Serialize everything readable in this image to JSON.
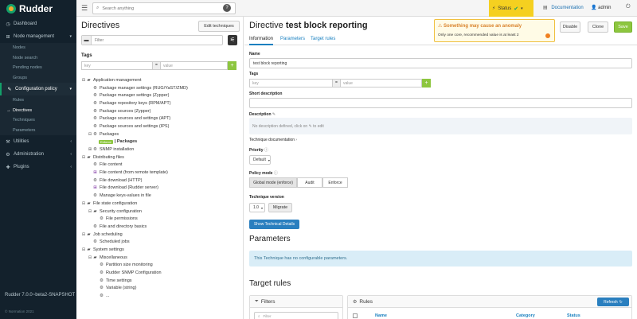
{
  "app": {
    "logo": "Rudder",
    "version": "Rudder 7.0.0~beta2-SNAPSHOT",
    "copyright": "© Normation 2021"
  },
  "sidebar": {
    "items": [
      {
        "label": "Dashboard",
        "icon": "dashboard-icon"
      },
      {
        "label": "Node management",
        "icon": "sitemap-icon"
      },
      {
        "label": "Configuration policy",
        "icon": "pencil-icon"
      },
      {
        "label": "Utilities",
        "icon": "wrench-icon"
      },
      {
        "label": "Administration",
        "icon": "gear-icon"
      },
      {
        "label": "Plugins",
        "icon": "puzzle-icon"
      }
    ],
    "node_sub": [
      "Nodes",
      "Node search",
      "Pending nodes",
      "Groups"
    ],
    "config_sub": [
      "Rules",
      "Directives",
      "Techniques",
      "Parameters"
    ]
  },
  "topbar": {
    "search_placeholder": "Search anything",
    "help": "?",
    "status": "Status",
    "documentation": "Documentation",
    "user": "admin"
  },
  "tree_panel": {
    "title": "Directives",
    "edit_button": "Edit techniques",
    "filter_placeholder": "Filter",
    "tags_title": "Tags",
    "key_placeholder": "key",
    "value_placeholder": "value",
    "eq": "=",
    "add": "+",
    "nodes": [
      {
        "level": 0,
        "toggle": "⊟",
        "icon": "folder",
        "label": "Application management"
      },
      {
        "level": 1,
        "toggle": "",
        "icon": "gear",
        "label": "Package manager settings (RUG/YaST/ZMD)"
      },
      {
        "level": 1,
        "toggle": "",
        "icon": "gear",
        "label": "Package manager settings (Zypper)"
      },
      {
        "level": 1,
        "toggle": "",
        "icon": "gear",
        "label": "Package repository keys (RPM/APT)"
      },
      {
        "level": 1,
        "toggle": "",
        "icon": "gear",
        "label": "Package sources (Zypper)"
      },
      {
        "level": 1,
        "toggle": "",
        "icon": "gear",
        "label": "Package sources and settings (APT)"
      },
      {
        "level": 1,
        "toggle": "",
        "icon": "gear",
        "label": "Package sources and settings (IPS)"
      },
      {
        "level": 1,
        "toggle": "⊟",
        "icon": "gear",
        "label": "Packages"
      },
      {
        "level": 2,
        "toggle": "",
        "icon": "badge",
        "badge": "Enforce",
        "label": "| Packages",
        "bold": true
      },
      {
        "level": 1,
        "toggle": "⊞",
        "icon": "gear",
        "label": "SNMP installation"
      },
      {
        "level": 0,
        "toggle": "⊟",
        "icon": "folder",
        "label": "Distributing files"
      },
      {
        "level": 1,
        "toggle": "",
        "icon": "gear",
        "label": "File content"
      },
      {
        "level": 1,
        "toggle": "",
        "icon": "win",
        "label": "File content (from remote template)"
      },
      {
        "level": 1,
        "toggle": "",
        "icon": "gear",
        "label": "File download (HTTP)"
      },
      {
        "level": 1,
        "toggle": "",
        "icon": "win",
        "label": "File download (Rudder server)"
      },
      {
        "level": 1,
        "toggle": "",
        "icon": "gear",
        "label": "Manage keys-values in file"
      },
      {
        "level": 0,
        "toggle": "⊟",
        "icon": "folder",
        "label": "File state configuration"
      },
      {
        "level": 1,
        "toggle": "⊟",
        "icon": "folder",
        "label": "Security configuration"
      },
      {
        "level": 2,
        "toggle": "",
        "icon": "gear",
        "label": "File permissions"
      },
      {
        "level": 1,
        "toggle": "",
        "icon": "gear",
        "label": "File and directory basics"
      },
      {
        "level": 0,
        "toggle": "⊟",
        "icon": "folder",
        "label": "Job scheduling"
      },
      {
        "level": 1,
        "toggle": "",
        "icon": "gear",
        "label": "Scheduled jobs"
      },
      {
        "level": 0,
        "toggle": "⊟",
        "icon": "folder",
        "label": "System settings"
      },
      {
        "level": 1,
        "toggle": "⊟",
        "icon": "folder",
        "label": "Miscellaneous"
      },
      {
        "level": 2,
        "toggle": "",
        "icon": "gear",
        "label": "Partition size monitoring"
      },
      {
        "level": 2,
        "toggle": "",
        "icon": "gear",
        "label": "Rudder SNMP Configuration"
      },
      {
        "level": 2,
        "toggle": "",
        "icon": "gear",
        "label": "Time settings"
      },
      {
        "level": 2,
        "toggle": "",
        "icon": "gear",
        "label": "Variable (string)"
      },
      {
        "level": 2,
        "toggle": "",
        "icon": "gear",
        "label": "..."
      }
    ]
  },
  "detail": {
    "title_prefix": "Directive",
    "title_name": "test block reporting",
    "alert_title": "Something may cause an anomaly",
    "alert_body": "Only one core, recommended value is at least 2",
    "buttons": {
      "disable": "Disable",
      "clone": "Clone",
      "save": "Save"
    },
    "tabs": [
      "Information",
      "Parameters",
      "Target rules"
    ],
    "name_label": "Name",
    "name_value": "test block reporting",
    "tags_label": "Tags",
    "key_placeholder": "key",
    "value_placeholder": "value",
    "short_desc_label": "Short description",
    "description_label": "Description",
    "description_placeholder": "No description defined, click on ✎ to edit",
    "tech_doc": "Technique documentation",
    "priority_label": "Priority",
    "priority_value": "Default",
    "policy_label": "Policy mode",
    "policy_modes": [
      "Global mode (enforce)",
      "Audit",
      "Enforce"
    ],
    "tech_version_label": "Technique version",
    "tech_version_value": "1.0",
    "migrate": "Migrate",
    "show_details": "Show Technical Details",
    "parameters_title": "Parameters",
    "parameters_info": "This Technique has no configurable parameters.",
    "target_rules_title": "Target rules",
    "filters_title": "Filters",
    "filters_input_placeholder": "Filter",
    "rules_title": "Rules",
    "refresh": "Refresh",
    "columns": [
      "Name",
      "Category",
      "Status"
    ]
  }
}
